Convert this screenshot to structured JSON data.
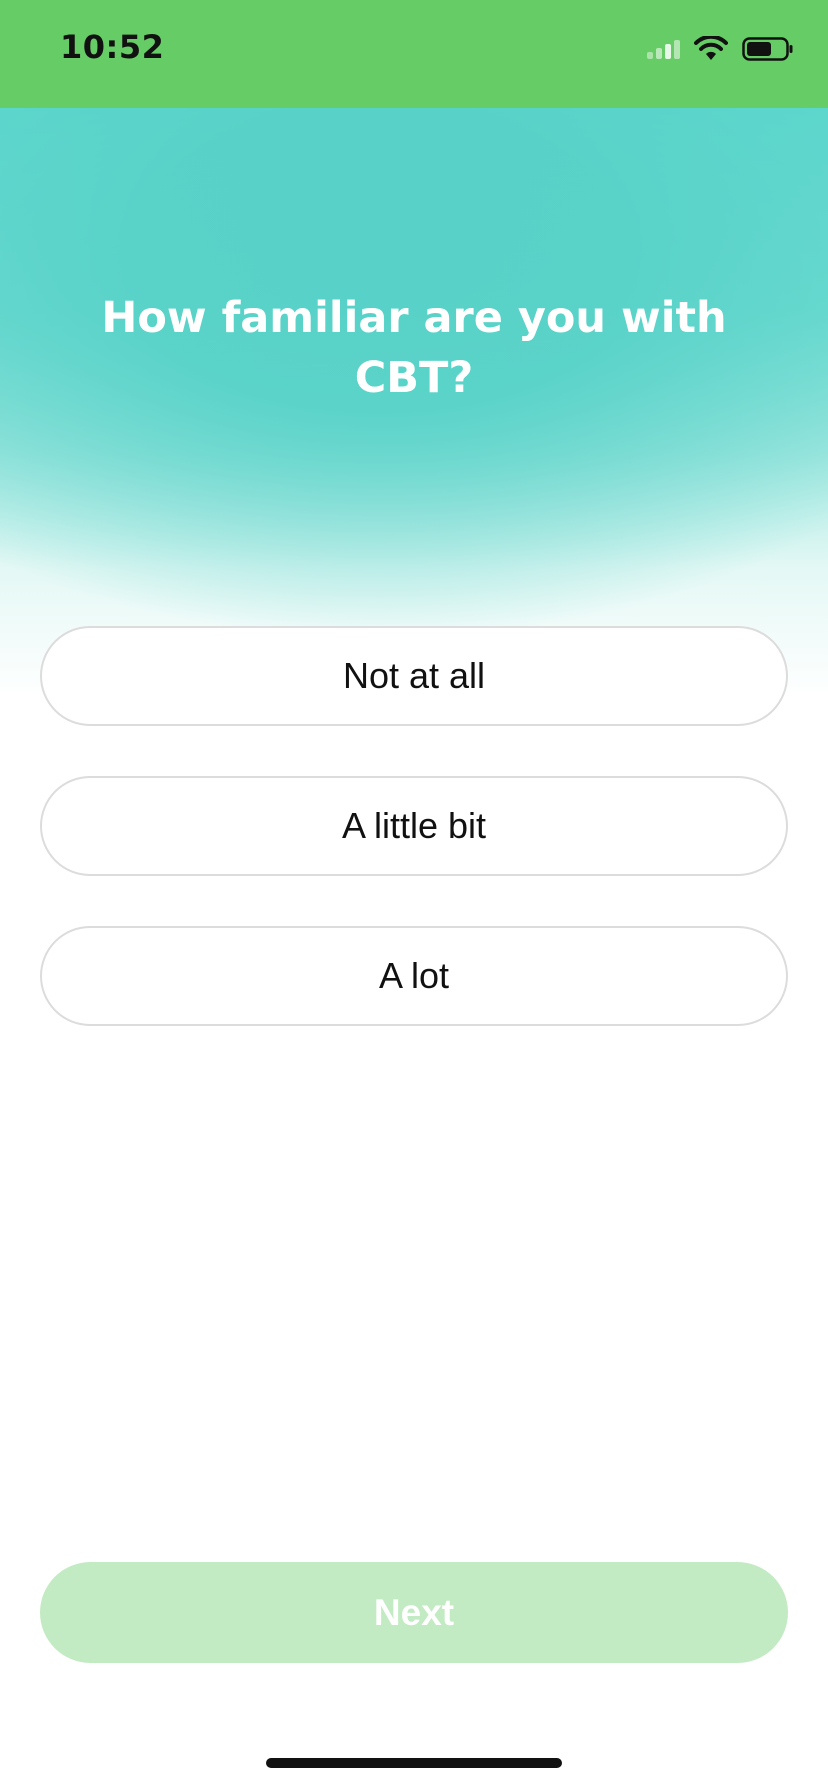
{
  "status_bar": {
    "time": "10:52",
    "icons": [
      "signal-icon",
      "wifi-icon",
      "battery-icon"
    ],
    "background": "#66cc66"
  },
  "question": {
    "title": "How familiar are you with CBT?"
  },
  "options": [
    {
      "label": "Not at all"
    },
    {
      "label": "A little bit"
    },
    {
      "label": "A lot"
    }
  ],
  "footer": {
    "next_label": "Next",
    "next_color": "#c3ebc3"
  }
}
